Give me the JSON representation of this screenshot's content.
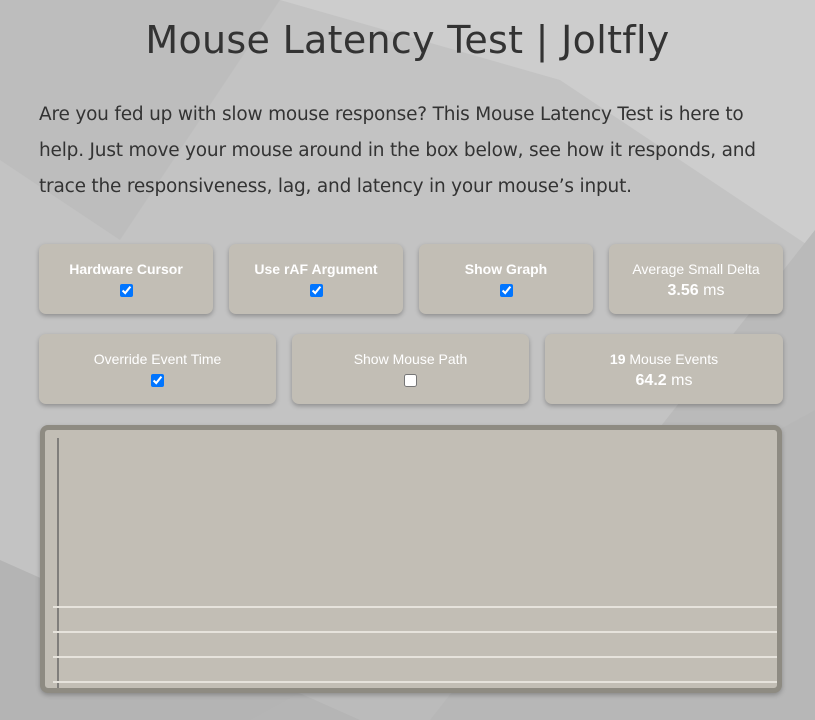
{
  "page": {
    "title": "Mouse Latency Test | Joltfly",
    "intro": "Are you fed up with slow mouse response? This Mouse Latency Test is here to help. Just move your mouse around in the box below, see how it responds, and trace the responsiveness, lag, and latency in your mouse’s input."
  },
  "controls": {
    "hardware_cursor": {
      "label": "Hardware Cursor",
      "checked": true
    },
    "raf_argument": {
      "label": "Use rAF Argument",
      "checked": true
    },
    "show_graph": {
      "label": "Show Graph",
      "checked": true
    },
    "average_small_delta": {
      "label": "Average Small Delta",
      "value": "3.56",
      "unit": "ms"
    },
    "override_event_time": {
      "label": "Override Event Time",
      "checked": true
    },
    "show_mouse_path": {
      "label": "Show Mouse Path",
      "checked": false
    },
    "mouse_events": {
      "count": "19",
      "label": "Mouse Events",
      "value": "64.2",
      "unit": "ms"
    }
  },
  "colors": {
    "background": "#c4c4c4",
    "card": "#c2beb5",
    "box_border": "#8e8b82",
    "graph_line": "#e6e3dc",
    "axis": "#555555"
  }
}
